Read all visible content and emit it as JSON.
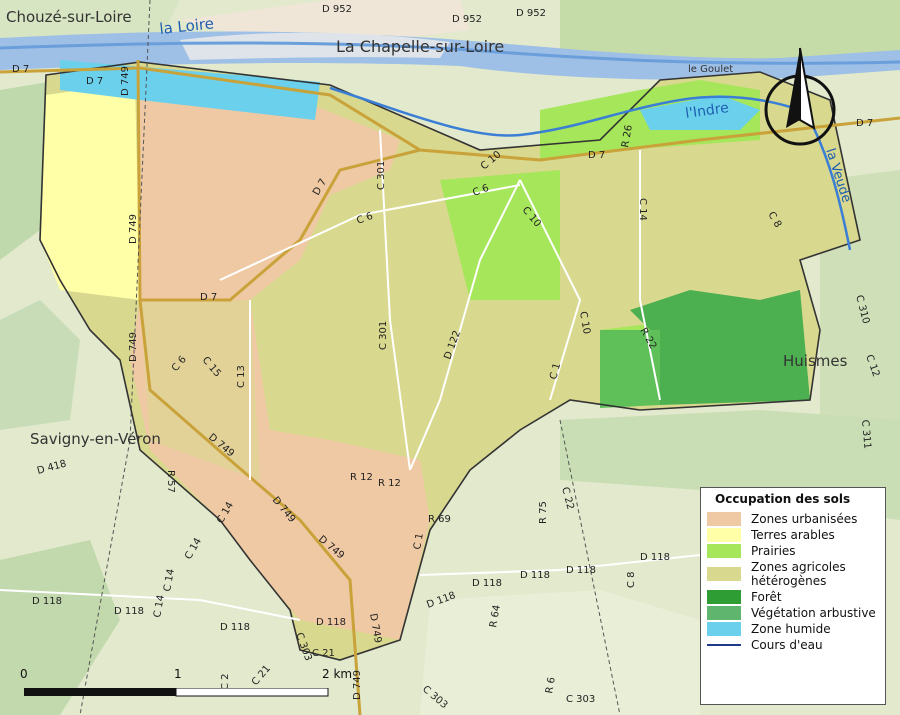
{
  "places": {
    "chouze": "Chouzé-sur-Loire",
    "chapelle": "La Chapelle-sur-Loire",
    "savigny": "Savigny-en-Véron",
    "huismes": "Huismes",
    "goulet": "le Goulet"
  },
  "rivers": {
    "loire": "la Loire",
    "indre": "l'Indre",
    "veude": "la Veude"
  },
  "roads": {
    "d952": "D 952",
    "d7": "D 7",
    "d749": "D 749",
    "d418": "D 418",
    "d118": "D 118",
    "c301": "C 301",
    "c6": "C 6",
    "c10": "C 10",
    "c14": "C 14",
    "c8": "C 8",
    "c13": "C 13",
    "c15": "C 15",
    "c1": "C 1",
    "c22": "C 22",
    "c303": "C 303",
    "c310": "C 310",
    "c12": "C 12",
    "c311": "C 311",
    "c2": "C 2",
    "c21": "C 21",
    "d122": "D 122",
    "r22": "R 22",
    "r26": "R 26",
    "r12": "R 12",
    "r57": "R 57",
    "r69": "R 69",
    "r75": "R 75",
    "r64": "R 64",
    "r6": "R 6"
  },
  "legend": {
    "title": "Occupation des sols",
    "items": [
      {
        "label": "Zones urbanisées",
        "color": "#efc9a4"
      },
      {
        "label": "Terres arables",
        "color": "#ffffa8"
      },
      {
        "label": "Prairies",
        "color": "#a6e65a"
      },
      {
        "label": "Zones agricoles hétérogènes",
        "color": "#d8d88e"
      },
      {
        "label": "Forêt",
        "color": "#2e9e34"
      },
      {
        "label": "Végétation arbustive",
        "color": "#5fb56e"
      },
      {
        "label": "Zone humide",
        "color": "#6ad0ec"
      }
    ],
    "line_item": "Cours d'eau"
  },
  "scale": {
    "t0": "0",
    "t1": "1",
    "t2": "2 km"
  },
  "compass": "north-arrow"
}
